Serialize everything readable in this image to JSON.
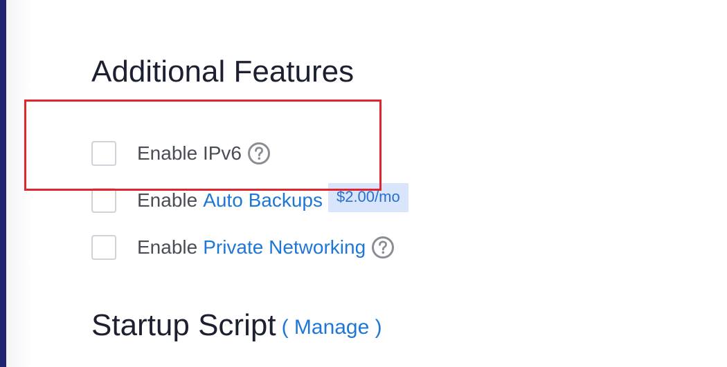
{
  "features": {
    "title": "Additional Features",
    "items": [
      {
        "label": "Enable IPv6",
        "link": "",
        "checked": false,
        "help_icon": "question-circle-icon"
      },
      {
        "label": "Enable",
        "link": "Auto Backups",
        "checked": false,
        "badge": "$2.00/mo"
      },
      {
        "label": "Enable",
        "link": "Private Networking",
        "checked": false,
        "help_icon": "question-circle-icon"
      }
    ]
  },
  "startup": {
    "title": "Startup Script",
    "manage_label": "( Manage )"
  },
  "colors": {
    "link": "#1e77d6",
    "highlight_border": "#e0252f",
    "badge_bg": "#d8e5fb",
    "sidebar": "#1a2470",
    "title": "#1d2030"
  }
}
